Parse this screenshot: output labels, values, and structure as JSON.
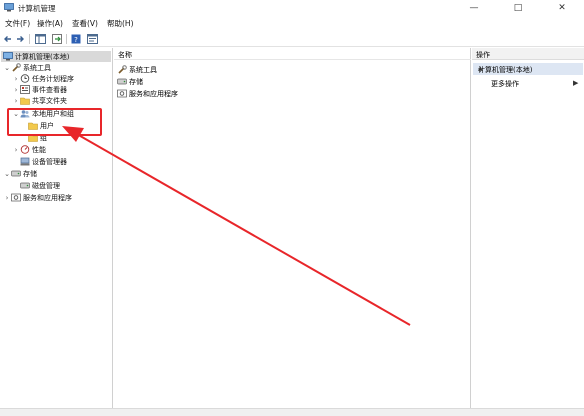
{
  "window": {
    "title": "计算机管理",
    "minimize": "—",
    "maximize": "□",
    "close": "✕"
  },
  "menu": [
    "文件(F)",
    "操作(A)",
    "查看(V)",
    "帮助(H)"
  ],
  "tree": {
    "root": "计算机管理(本地)",
    "system_tools": "系统工具",
    "task_scheduler": "任务计划程序",
    "event_viewer": "事件查看器",
    "shared_folders": "共享文件夹",
    "local_users_groups": "本地用户和组",
    "users": "用户",
    "groups": "组",
    "performance": "性能",
    "device_manager": "设备管理器",
    "storage": "存储",
    "disk_management": "磁盘管理",
    "services_apps": "服务和应用程序"
  },
  "center": {
    "column_name": "名称",
    "items": [
      "系统工具",
      "存储",
      "服务和应用程序"
    ]
  },
  "actions": {
    "header": "操作",
    "section": "计算机管理(本地)",
    "more": "更多操作"
  },
  "colors": {
    "highlight": "#e8262a",
    "arrow": "#e8262a",
    "action_selected": "#dde6f3"
  },
  "icons": [
    "app-icon",
    "back-icon",
    "forward-icon",
    "console-tree-icon",
    "export-icon",
    "help-icon",
    "properties-icon",
    "computer-icon",
    "tools-icon",
    "clock-icon",
    "event-icon",
    "folder-icon",
    "users-icon",
    "gauge-icon",
    "device-icon",
    "disk-icon",
    "services-icon"
  ]
}
